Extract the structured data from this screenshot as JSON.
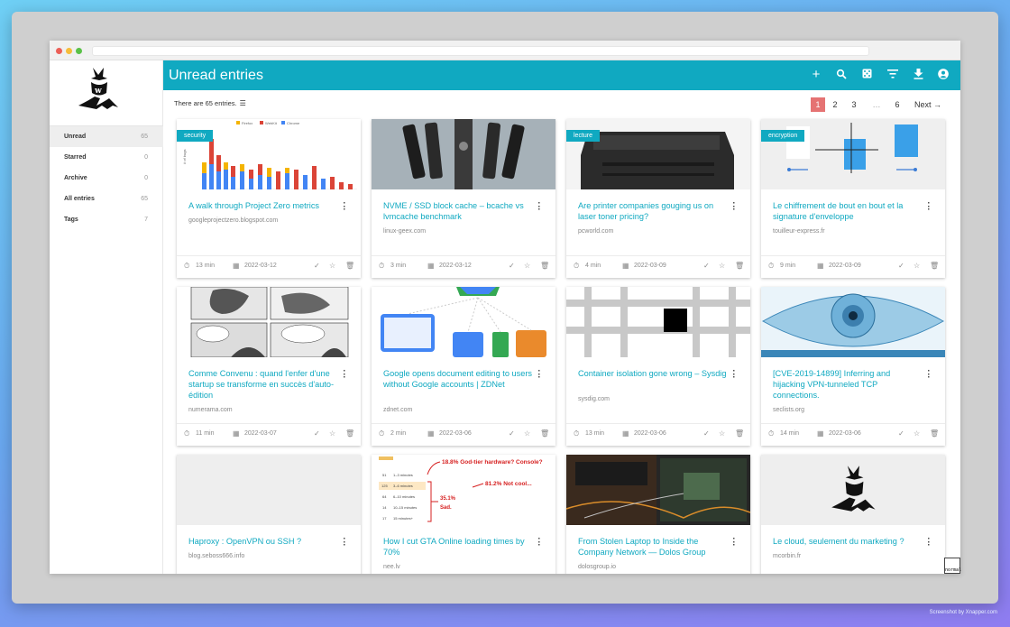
{
  "page": {
    "credit": "Screenshot by Xnapper.com"
  },
  "sidebar": {
    "items": [
      {
        "label": "Unread",
        "count": "65"
      },
      {
        "label": "Starred",
        "count": "0"
      },
      {
        "label": "Archive",
        "count": "0"
      },
      {
        "label": "All entries",
        "count": "65"
      },
      {
        "label": "Tags",
        "count": "7"
      }
    ]
  },
  "topbar": {
    "title": "Unread entries",
    "icons": [
      "add-icon",
      "search-icon",
      "random-icon",
      "filter-icon",
      "download-icon",
      "account-icon"
    ]
  },
  "list": {
    "count_text": "There are 65 entries.",
    "pager": {
      "pages": [
        "1",
        "2",
        "3",
        "…",
        "6"
      ],
      "next": "Next →",
      "active": "1"
    }
  },
  "entries": [
    {
      "title": "A walk through Project Zero metrics",
      "domain": "googleprojectzero.blogspot.com",
      "time": "13 min",
      "date": "2022-03-12",
      "tag": "security",
      "chart_legend": [
        "Firefox",
        "WebKit",
        "Chrome"
      ],
      "chart_ylabel": "# of bugs"
    },
    {
      "title": "NVME / SSD block cache – bcache vs lvmcache benchmark",
      "domain": "linux-geex.com",
      "time": "3 min",
      "date": "2022-03-12",
      "tag": ""
    },
    {
      "title": "Are printer companies gouging us on laser toner pricing?",
      "domain": "pcworld.com",
      "time": "4 min",
      "date": "2022-03-09",
      "tag": "lecture"
    },
    {
      "title": "Le chiffrement de bout en bout et la signature d'enveloppe",
      "domain": "touilleur-express.fr",
      "time": "9 min",
      "date": "2022-03-09",
      "tag": "encryption"
    },
    {
      "title": "Comme Convenu : quand l'enfer d'une startup se transforme en succès d'auto-édition",
      "domain": "numerama.com",
      "time": "11 min",
      "date": "2022-03-07",
      "tag": ""
    },
    {
      "title": "Google opens document editing to users without Google accounts | ZDNet",
      "domain": "zdnet.com",
      "time": "2 min",
      "date": "2022-03-06",
      "tag": ""
    },
    {
      "title": "Container isolation gone wrong – Sysdig",
      "domain": "sysdig.com",
      "time": "13 min",
      "date": "2022-03-06",
      "tag": ""
    },
    {
      "title": "[CVE-2019-14899] Inferring and hijacking VPN-tunneled TCP connections.",
      "domain": "seclists.org",
      "time": "14 min",
      "date": "2022-03-06",
      "tag": ""
    },
    {
      "title": "Haproxy : OpenVPN ou SSH ?",
      "domain": "blog.seboss666.info",
      "time": "",
      "date": "",
      "tag": ""
    },
    {
      "title": "How I cut GTA Online loading times by 70%",
      "domain": "nee.lv",
      "time": "",
      "date": "",
      "tag": "",
      "annotations": [
        "18.8% God-tier hardware? Console?",
        "81.2% Not cool...",
        "35.1%",
        "Sad."
      ],
      "gta_table": [
        [
          "51",
          "1–3 minutes"
        ],
        [
          "125",
          "3–6 minutes"
        ],
        [
          "64",
          "6–10 minutes"
        ],
        [
          "14",
          "10–15 minutes"
        ],
        [
          "17",
          "15 minutes+"
        ]
      ]
    },
    {
      "title": "From Stolen Laptop to Inside the Company Network — Dolos Group",
      "domain": "dolosgroup.io",
      "time": "",
      "date": "",
      "tag": ""
    },
    {
      "title": "Le cloud, seulement du marketing ?",
      "domain": "mcorbin.fr",
      "time": "",
      "date": "",
      "tag": ""
    }
  ],
  "badge": "normal"
}
